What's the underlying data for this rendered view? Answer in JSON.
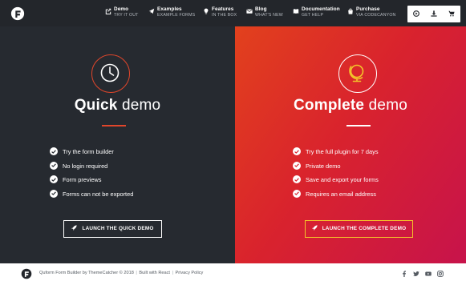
{
  "header": {
    "logo_icon": "quform-logo-icon",
    "nav": [
      {
        "title": "Demo",
        "subtitle": "TRY IT OUT",
        "icon": "external-link-icon"
      },
      {
        "title": "Examples",
        "subtitle": "EXAMPLE FORMS",
        "icon": "paper-plane-icon"
      },
      {
        "title": "Features",
        "subtitle": "IN THE BOX",
        "icon": "lightbulb-icon"
      },
      {
        "title": "Blog",
        "subtitle": "WHAT'S NEW",
        "icon": "envelope-icon"
      },
      {
        "title": "Documentation",
        "subtitle": "GET HELP",
        "icon": "book-icon"
      },
      {
        "title": "Purchase",
        "subtitle": "VIA CODECANYON",
        "icon": "shopping-bag-icon"
      }
    ],
    "buttons": [
      {
        "icon": "play-circle-icon"
      },
      {
        "icon": "download-icon"
      },
      {
        "icon": "cart-icon"
      }
    ]
  },
  "quick": {
    "icon": "clock-icon",
    "title_bold": "Quick",
    "title_light": "demo",
    "features": [
      "Try the form builder",
      "No login required",
      "Form previews",
      "Forms can not be exported"
    ],
    "cta": "LAUNCH THE QUICK DEMO"
  },
  "complete": {
    "icon": "globe-icon",
    "title_bold": "Complete",
    "title_light": "demo",
    "features": [
      "Try the full plugin for 7 days",
      "Private demo",
      "Save and export your forms",
      "Requires an email address"
    ],
    "cta": "LAUNCH THE COMPLETE DEMO"
  },
  "footer": {
    "copyright": "Quform Form Builder by ThemeCatcher © 2018",
    "built_with": "Built with React",
    "privacy": "Privacy Policy",
    "social": [
      "facebook-icon",
      "twitter-icon",
      "youtube-icon",
      "instagram-icon"
    ]
  },
  "colors": {
    "dark_bg": "#262a30",
    "header_bg": "#23262b",
    "accent_orange": "#e1462b",
    "gradient_start": "#e2411d",
    "gradient_end": "#c7134b",
    "cta_highlight": "#f3c42a"
  }
}
